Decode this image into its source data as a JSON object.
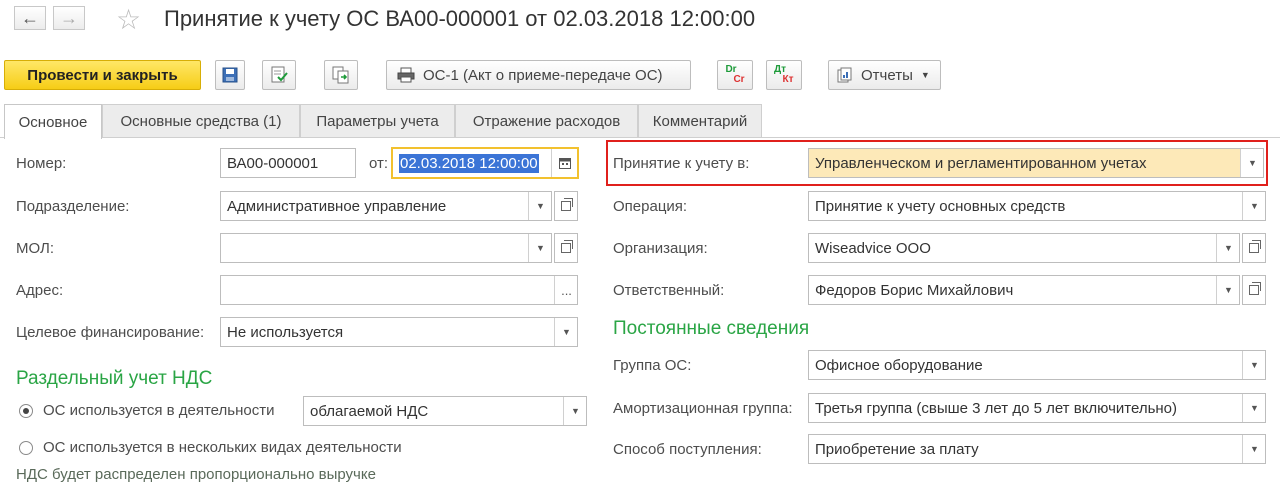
{
  "window": {
    "title": "Принятие к учету ОС ВА00-000001 от 02.03.2018 12:00:00"
  },
  "toolbar": {
    "post_close": "Провести и закрыть",
    "print_form": "ОС-1 (Акт о приеме-передаче ОС)",
    "dr_cr_top": "Dr",
    "dr_cr_bottom": "Cr",
    "dt_kt_top": "Дт",
    "dt_kt_bottom": "Кт",
    "reports": "Отчеты"
  },
  "tabs": [
    {
      "label": "Основное",
      "active": true
    },
    {
      "label": "Основные средства (1)",
      "active": false
    },
    {
      "label": "Параметры учета",
      "active": false
    },
    {
      "label": "Отражение расходов",
      "active": false
    },
    {
      "label": "Комментарий",
      "active": false
    }
  ],
  "left": {
    "number_label": "Номер:",
    "number_value": "ВА00-000001",
    "date_label": "от:",
    "date_value": "02.03.2018 12:00:00",
    "division_label": "Подразделение:",
    "division_value": "Административное управление",
    "mol_label": "МОЛ:",
    "mol_value": "",
    "address_label": "Адрес:",
    "address_value": "",
    "address_button": "...",
    "financing_label": "Целевое финансирование:",
    "financing_value": "Не используется"
  },
  "vat": {
    "title": "Раздельный учет НДС",
    "option1": "ОС используется в деятельности",
    "option1_value": "облагаемой НДС",
    "option2": "ОС используется в нескольких видах деятельности",
    "note": "НДС будет распределен пропорционально выручке"
  },
  "right": {
    "accounting_label": "Принятие к учету в:",
    "accounting_value": "Управленческом и регламентированном учетах",
    "operation_label": "Операция:",
    "operation_value": "Принятие к учету основных средств",
    "org_label": "Организация:",
    "org_value": "Wiseadvice ООО",
    "responsible_label": "Ответственный:",
    "responsible_value": "Федоров Борис Михайлович"
  },
  "permanent": {
    "title": "Постоянные сведения",
    "group_label": "Группа ОС:",
    "group_value": "Офисное оборудование",
    "amort_label": "Амортизационная группа:",
    "amort_value": "Третья группа (свыше 3 лет до 5 лет включительно)",
    "receipt_label": "Способ поступления:",
    "receipt_value": "Приобретение за плату"
  },
  "colors": {
    "primary_button": "#f6cd16",
    "section_title": "#2aa545",
    "highlight_border": "#e0201c",
    "highlight_fill": "#fde9b8",
    "date_focus": "#f2c12e"
  }
}
